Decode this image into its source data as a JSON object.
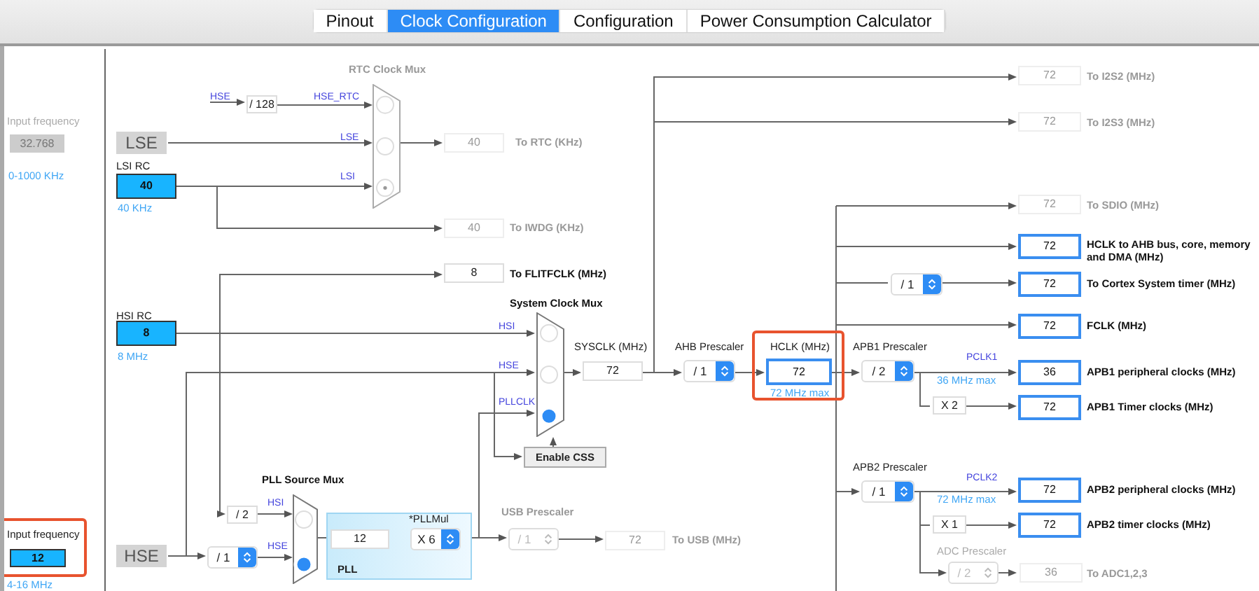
{
  "tabs": [
    {
      "label": "Pinout",
      "selected": false
    },
    {
      "label": "Clock Configuration",
      "selected": true
    },
    {
      "label": "Configuration",
      "selected": false
    },
    {
      "label": "Power Consumption Calculator",
      "selected": false
    }
  ],
  "items": [
    {
      "kind": "muted-label",
      "text": "Input frequency"
    },
    {
      "kind": "source-value",
      "value": "32.768",
      "disabled": true
    },
    {
      "kind": "hint",
      "text": "0-1000 KHz"
    },
    {
      "kind": "source-block",
      "text": "LSE"
    },
    {
      "kind": "label",
      "text": "LSI RC"
    },
    {
      "kind": "source-value",
      "value": "40",
      "disabled": false
    },
    {
      "kind": "hint",
      "text": "40 KHz"
    },
    {
      "kind": "signal",
      "text": "HSE"
    },
    {
      "kind": "value",
      "value": "/ 128",
      "disabled": false
    },
    {
      "kind": "signal",
      "text": "HSE_RTC"
    },
    {
      "kind": "muted-title",
      "text": "RTC Clock Mux"
    },
    {
      "kind": "mux",
      "disabled": true,
      "inputs": [
        {
          "selected": false
        },
        {
          "selected": false
        },
        {
          "selected": true
        }
      ]
    },
    {
      "kind": "signal",
      "text": "LSE"
    },
    {
      "kind": "signal",
      "text": "LSI"
    },
    {
      "kind": "value",
      "value": "40",
      "disabled": true
    },
    {
      "kind": "muted-title",
      "text": "To RTC (KHz)"
    },
    {
      "kind": "value",
      "value": "40",
      "disabled": true
    },
    {
      "kind": "muted-title",
      "text": "To IWDG (KHz)"
    },
    {
      "kind": "value",
      "value": "8",
      "disabled": false
    },
    {
      "kind": "title",
      "text": "To FLITFCLK (MHz)"
    },
    {
      "kind": "label",
      "text": "HSI RC"
    },
    {
      "kind": "source-value",
      "value": "8",
      "disabled": false
    },
    {
      "kind": "hint",
      "text": "8 MHz"
    },
    {
      "kind": "title",
      "text": "System Clock Mux"
    },
    {
      "kind": "mux",
      "disabled": false,
      "inputs": [
        {
          "selected": false
        },
        {
          "selected": false
        },
        {
          "selected": true
        }
      ]
    },
    {
      "kind": "signal",
      "text": "HSI"
    },
    {
      "kind": "signal",
      "text": "HSE"
    },
    {
      "kind": "signal",
      "text": "PLLCLK"
    },
    {
      "kind": "label",
      "text": "SYSCLK (MHz)"
    },
    {
      "kind": "value",
      "value": "72",
      "disabled": false
    },
    {
      "kind": "button",
      "text": "Enable CSS"
    },
    {
      "kind": "label",
      "text": "AHB Prescaler"
    },
    {
      "kind": "select",
      "value": "/ 1",
      "disabled": false
    },
    {
      "kind": "frame"
    },
    {
      "kind": "label",
      "text": "HCLK (MHz)"
    },
    {
      "kind": "output-value",
      "value": "72"
    },
    {
      "kind": "hint",
      "text": "72 MHz max"
    },
    {
      "kind": "label",
      "text": "APB1 Prescaler"
    },
    {
      "kind": "select",
      "value": "/ 2",
      "disabled": false
    },
    {
      "kind": "signal",
      "text": "PCLK1"
    },
    {
      "kind": "hint",
      "text": "36 MHz max"
    },
    {
      "kind": "value",
      "value": "X 2",
      "disabled": false
    },
    {
      "kind": "value",
      "value": "72",
      "disabled": true
    },
    {
      "kind": "muted-title",
      "text": "To I2S2 (MHz)"
    },
    {
      "kind": "value",
      "value": "72",
      "disabled": true
    },
    {
      "kind": "muted-title",
      "text": "To I2S3 (MHz)"
    },
    {
      "kind": "value",
      "value": "72",
      "disabled": true
    },
    {
      "kind": "muted-title",
      "text": "To SDIO (MHz)"
    },
    {
      "kind": "output-value",
      "value": "72"
    },
    {
      "kind": "title",
      "text": "HCLK to AHB bus, core, memory and DMA (MHz)"
    },
    {
      "kind": "select",
      "value": "/ 1",
      "disabled": false
    },
    {
      "kind": "output-value",
      "value": "72"
    },
    {
      "kind": "title",
      "text": "To Cortex System timer (MHz)"
    },
    {
      "kind": "output-value",
      "value": "72"
    },
    {
      "kind": "title",
      "text": "FCLK (MHz)"
    },
    {
      "kind": "output-value",
      "value": "36"
    },
    {
      "kind": "title",
      "text": "APB1 peripheral clocks (MHz)"
    },
    {
      "kind": "output-value",
      "value": "72"
    },
    {
      "kind": "title",
      "text": "APB1 Timer clocks (MHz)"
    },
    {
      "kind": "label",
      "text": "APB2 Prescaler"
    },
    {
      "kind": "select",
      "value": "/ 1",
      "disabled": false
    },
    {
      "kind": "signal",
      "text": "PCLK2"
    },
    {
      "kind": "hint",
      "text": "72 MHz max"
    },
    {
      "kind": "output-value",
      "value": "72"
    },
    {
      "kind": "title",
      "text": "APB2 peripheral clocks (MHz)"
    },
    {
      "kind": "value",
      "value": "X 1",
      "disabled": false
    },
    {
      "kind": "output-value",
      "value": "72"
    },
    {
      "kind": "title",
      "text": "APB2 timer clocks (MHz)"
    },
    {
      "kind": "muted-label",
      "text": "ADC Prescaler"
    },
    {
      "kind": "select",
      "value": "/ 2",
      "disabled": true
    },
    {
      "kind": "value",
      "value": "36",
      "disabled": true
    },
    {
      "kind": "muted-title",
      "text": "To ADC1,2,3"
    },
    {
      "kind": "title",
      "text": "PLL Source Mux"
    },
    {
      "kind": "mux",
      "disabled": false,
      "inputs": [
        {
          "selected": false
        },
        {
          "selected": true
        }
      ]
    },
    {
      "kind": "signal",
      "text": "HSI"
    },
    {
      "kind": "signal",
      "text": "HSE"
    },
    {
      "kind": "value",
      "value": "/ 2",
      "disabled": false
    },
    {
      "kind": "pll-panel",
      "text": "PLL"
    },
    {
      "kind": "value",
      "value": "12",
      "disabled": false
    },
    {
      "kind": "label",
      "text": "*PLLMul"
    },
    {
      "kind": "select",
      "value": "X 6",
      "disabled": false
    },
    {
      "kind": "muted-title",
      "text": "USB Prescaler"
    },
    {
      "kind": "select",
      "value": "/ 1",
      "disabled": true
    },
    {
      "kind": "value",
      "value": "72",
      "disabled": true
    },
    {
      "kind": "muted-title",
      "text": "To USB (MHz)"
    },
    {
      "kind": "frame"
    },
    {
      "kind": "label",
      "text": "Input frequency"
    },
    {
      "kind": "source-value",
      "value": "12",
      "disabled": false
    },
    {
      "kind": "hint",
      "text": "4-16 MHz"
    },
    {
      "kind": "source-block",
      "text": "HSE"
    },
    {
      "kind": "select",
      "value": "/ 1",
      "disabled": false
    }
  ]
}
